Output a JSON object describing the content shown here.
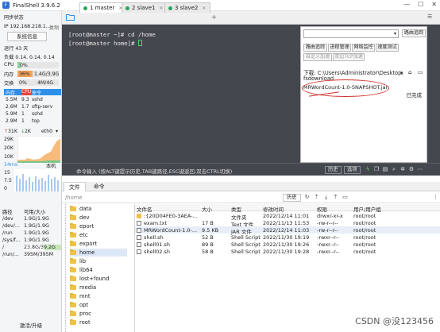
{
  "app": {
    "title": "FinalShell 3.9.6.2"
  },
  "left": {
    "sync_status": "同步状态",
    "ip": "IP 192.168.218.1...",
    "copy": "复制",
    "sys_info_btn": "系统信息",
    "uptime": "运行 43 天",
    "load": "负载 0.14, 0.14, 0.14",
    "cpu_label": "CPU",
    "cpu_value": "0%",
    "cpu_percent": 0,
    "mem_label": "内存",
    "mem_percent_text": "36%",
    "mem_percent": 36,
    "mem_value": "1.4G/3.9G",
    "swap_label": "交换",
    "swap_percent_text": "0%",
    "swap_value": "4M/4G",
    "proc_headers": [
      "内存",
      "CPU",
      "命令"
    ],
    "processes": [
      {
        "mem": "5.5M",
        "cpu": "9.3",
        "cmd": "sshd"
      },
      {
        "mem": "2.6M",
        "cpu": "1.7",
        "cmd": "sftp-serv"
      },
      {
        "mem": "5.9M",
        "cpu": "1",
        "cmd": "sshd"
      },
      {
        "mem": "2.9M",
        "cpu": "1",
        "cmd": "top"
      }
    ],
    "net_up": "31K",
    "net_down": "2K",
    "net_iface": "eth0",
    "net_ticks": [
      "29K",
      "20K",
      "10K"
    ],
    "latency_label": "14ms",
    "latency_local": "本机",
    "latency_ticks": [
      "15",
      "7.5",
      "0"
    ],
    "disk_headers": [
      "路径",
      "可用/大小"
    ],
    "disks": [
      {
        "path": "/dev",
        "size": "1.9G/1.9G"
      },
      {
        "path": "/dev/...",
        "size": "1.9G/1.9G"
      },
      {
        "path": "/run",
        "size": "1.9G/1.9G"
      },
      {
        "path": "/sys/f...",
        "size": "1.9G/1.9G"
      },
      {
        "path": "/",
        "size": "23.8G/39.2G"
      },
      {
        "path": "/run/...",
        "size": "395M/395M"
      }
    ],
    "upgrade": "激活/升级"
  },
  "tabs": [
    {
      "label": "1 master",
      "active": true
    },
    {
      "label": "2 slave1",
      "active": false
    },
    {
      "label": "3 slave2",
      "active": false
    }
  ],
  "terminal": {
    "line1": "[root@master ~]# cd /home",
    "line2": "[root@master home]# "
  },
  "panel": {
    "route_btn": "路由追踪",
    "buttons_row1": [
      "路由追踪",
      "进程管理",
      "网络监控",
      "速度测试"
    ],
    "buttons_row2": [
      "自定义加速",
      "双边TCP加速"
    ],
    "download_label": "下载: C:\\Users\\Administrator\\Desktop\\",
    "download_path": "fsdownload",
    "file": "MRWordCount-1.0-SNAPSHOT.jar",
    "status": "已完成"
  },
  "cmdbar": {
    "hint": "命令输入 (按ALT键提示历史,TAB键路径,ESC键返回,双击CTRL切换)",
    "history": "历史",
    "options": "选项"
  },
  "filetabs": [
    "文件",
    "命令"
  ],
  "pathbar": {
    "path": "/home",
    "history": "历史"
  },
  "tree": [
    "data",
    "dev",
    "eport",
    "etc",
    "export",
    "home",
    "lib",
    "lib64",
    "lost+found",
    "media",
    "mnt",
    "opt",
    "proc",
    "root"
  ],
  "tree_selected": "home",
  "files": {
    "headers": [
      "文件名",
      "大小",
      "类型",
      "修改时间",
      "权限",
      "用户/用户组"
    ],
    "rows": [
      {
        "name": ":{20D04FE0-3AEA-...",
        "size": "",
        "type": "文件夹",
        "mtime": "2022/12/14 11:01",
        "perm": "drwxr-xr-x",
        "owner": "root/root",
        "icon": "folder"
      },
      {
        "name": "exam.txt",
        "size": "17 B",
        "type": "Text 文件",
        "mtime": "2022/11/13 11:53",
        "perm": "-rw-r--r--",
        "owner": "root/root",
        "icon": "file"
      },
      {
        "name": "MRWordCount-1.0-...",
        "size": "9.5 KB",
        "type": "JAR 文件",
        "mtime": "2022/12/14 11:03",
        "perm": "-rw-r--r--",
        "owner": "root/root",
        "icon": "file"
      },
      {
        "name": "shell.sh",
        "size": "52 B",
        "type": "Shell Script",
        "mtime": "2022/11/30 19:19",
        "perm": "-rwxr--r--",
        "owner": "root/root",
        "icon": "file"
      },
      {
        "name": "shell01.sh",
        "size": "89 B",
        "type": "Shell Script",
        "mtime": "2022/11/30 19:26",
        "perm": "-rwxr--r--",
        "owner": "root/root",
        "icon": "file"
      },
      {
        "name": "shell02.sh",
        "size": "58 B",
        "type": "Shell Script",
        "mtime": "2022/11/30 19:28",
        "perm": "-rwxr--r--",
        "owner": "root/root",
        "icon": "file"
      }
    ]
  },
  "watermark": "CSDN @没123456",
  "colors": {
    "accent": "#2f8fe8",
    "cpu_red": "#e4473f",
    "terminal_bg": "#44484e",
    "mem_orange": "#f5a35a",
    "green": "#26a65b"
  }
}
